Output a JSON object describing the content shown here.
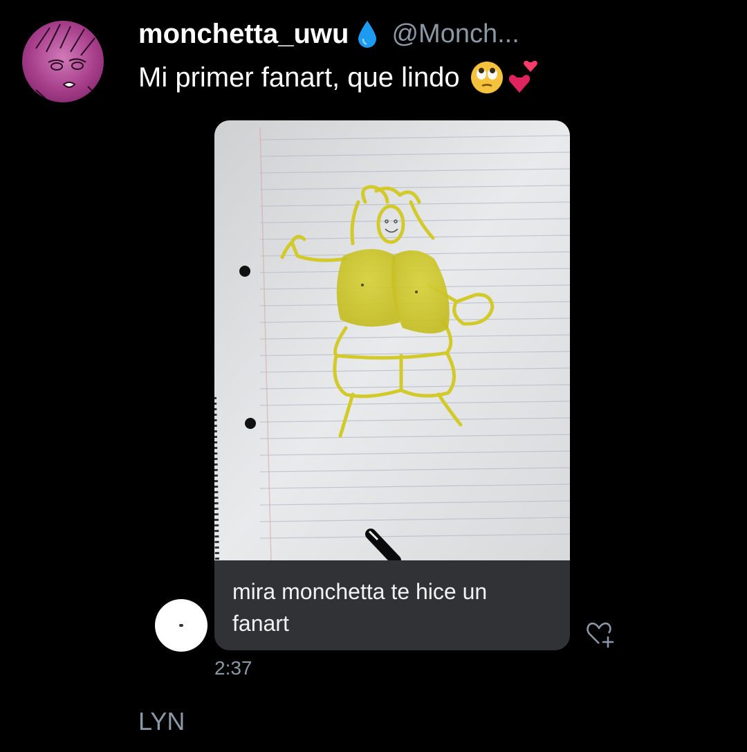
{
  "tweet": {
    "display_name": "monchetta_uwu",
    "handle": "@Monch...",
    "text": "Mi primer fanart, que lindo",
    "badge_icon": "water-drop-icon",
    "emojis": [
      "face-with-rolling-eyes-emoji",
      "two-hearts-emoji"
    ]
  },
  "embedded_message": {
    "image": "photo of a yellow marker drawing on lined notebook paper",
    "caption": "mira monchetta te hice un fanart",
    "timestamp": "2:37",
    "react_icon": "add-reaction-heart-icon"
  },
  "footer": {
    "label": "LYN"
  },
  "colors": {
    "background": "#000000",
    "secondary_text": "#8b98a5",
    "caption_bg": "#303236",
    "drop": "#1d9bf0",
    "drawing": "#d9d21e"
  }
}
